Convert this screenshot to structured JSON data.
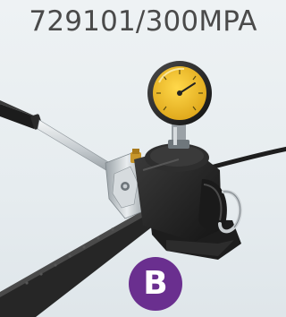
{
  "title": "729101/300MPA",
  "badge": {
    "letter": "B",
    "color": "#6a2f8f"
  },
  "illustration": {
    "subject": "hydraulic-hand-pump-with-pressure-gauge",
    "gauge_face_color": "#f2c230",
    "pump_body_color": "#2b2b2b",
    "handle_color": "#c9ced2"
  }
}
